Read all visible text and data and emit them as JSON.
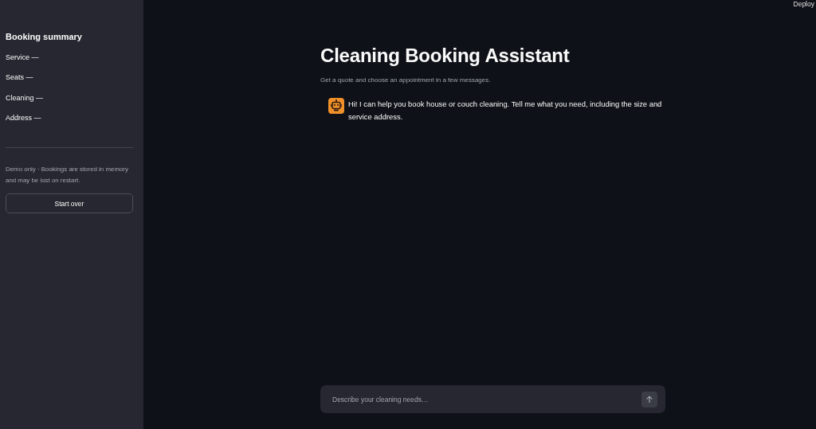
{
  "header": {
    "deploy": "Deploy"
  },
  "sidebar": {
    "title": "Booking summary",
    "items": [
      {
        "label": "Service —"
      },
      {
        "label": "Seats —"
      },
      {
        "label": "Cleaning —"
      },
      {
        "label": "Address —"
      }
    ],
    "note": "Demo only · Bookings are stored in memory and may be lost on restart.",
    "button": "Start over"
  },
  "main": {
    "title": "Cleaning Booking Assistant",
    "subtitle": "Get a quote and choose an appointment in a few messages.",
    "messages": [
      {
        "text": "Hi! I can help you book house or couch cleaning. Tell me what you need, including the size and service address."
      }
    ]
  },
  "chat_input": {
    "placeholder": "Describe your cleaning needs…"
  }
}
